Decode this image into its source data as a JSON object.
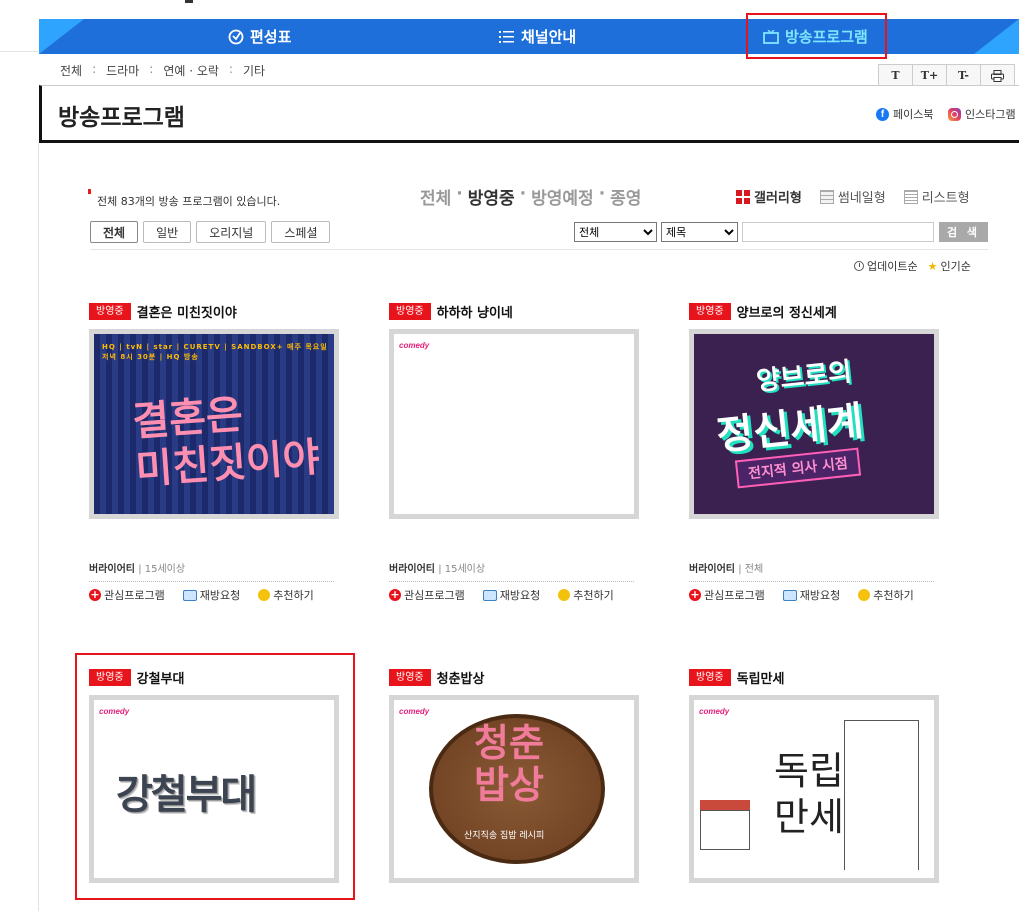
{
  "topnav": {
    "items": [
      {
        "label": "편성표",
        "icon": "clock-icon"
      },
      {
        "label": "채널안내",
        "icon": "list-icon"
      },
      {
        "label": "방송프로그램",
        "icon": "tv-icon"
      }
    ],
    "active": "방송프로그램"
  },
  "subnav": [
    "전체",
    "드라마",
    "연예 · 오락",
    "기타"
  ],
  "font_tools": [
    "T",
    "T+",
    "T-",
    "⎙"
  ],
  "page_title": "방송프로그램",
  "social": {
    "facebook": "페이스북",
    "instagram": "인스타그램"
  },
  "count_text": "전체 83개의 방송 프로그램이 있습니다.",
  "status_filters": {
    "all": "전체",
    "airing": "방영중",
    "upcoming": "방영예정",
    "ended": "종영",
    "dot": "·"
  },
  "view_modes": {
    "gallery": "갤러리형",
    "thumbnail": "썸네일형",
    "list": "리스트형"
  },
  "category_tabs": [
    "전체",
    "일반",
    "오리지널",
    "스페셜"
  ],
  "search": {
    "scope": "전체",
    "field": "제목",
    "button": "검 색"
  },
  "sort": {
    "update": "업데이트순",
    "popular": "인기순"
  },
  "programs": [
    {
      "badge": "방영중",
      "title": "결혼은 미친짓이야",
      "genre": "버라이어티",
      "rating": "15세이상",
      "art_text": "결혼은\n미친짓이야",
      "strip": "HQ | tvN | star | CURETV | SANDBOX+    매주 목요일 저녁 8시 30분 | HQ 방송"
    },
    {
      "badge": "방영중",
      "title": "하하하 냥이네",
      "genre": "버라이어티",
      "rating": "15세이상",
      "logo": "comedy"
    },
    {
      "badge": "방영중",
      "title": "양브로의 정신세계",
      "genre": "버라이어티",
      "rating": "전체",
      "art_l1": "양브로의",
      "art_l2": "정신세계",
      "art_l3": "전지적 의사 시점"
    },
    {
      "badge": "방영중",
      "title": "강철부대",
      "logo": "comedy",
      "art_text": "강철부대"
    },
    {
      "badge": "방영중",
      "title": "청춘밥상",
      "logo": "comedy",
      "art_text": "청춘\n밥상",
      "art_sub": "산지직송 집밥 레시피"
    },
    {
      "badge": "방영중",
      "title": "독립만세",
      "logo": "comedy",
      "art_text": "독립\n만세"
    }
  ],
  "actions": {
    "favorite": "관심프로그램",
    "rerun": "재방요청",
    "recommend": "추천하기",
    "sep": "|"
  },
  "colors": {
    "nav_blue": "#1e6fd9",
    "accent_red": "#e8141b",
    "active_nav_text": "#7fe6ff"
  }
}
